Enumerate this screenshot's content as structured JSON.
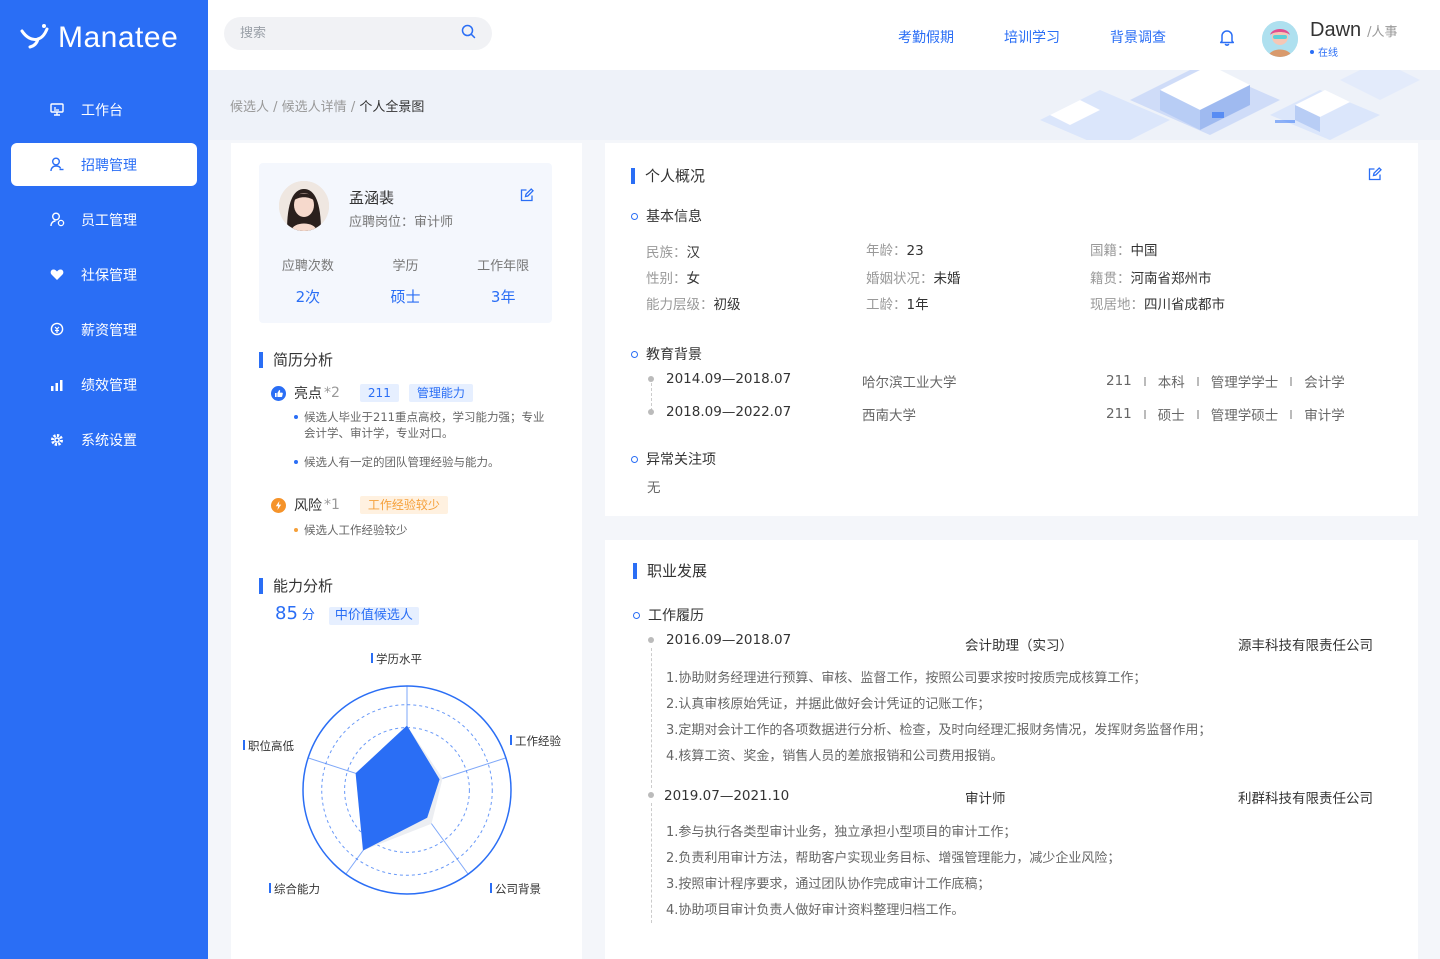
{
  "brand": {
    "name": "Manatee"
  },
  "sidebar": {
    "items": [
      {
        "label": "工作台",
        "icon": "monitor-icon",
        "active": false
      },
      {
        "label": "招聘管理",
        "icon": "user-icon",
        "active": true
      },
      {
        "label": "员工管理",
        "icon": "user-gear-icon",
        "active": false
      },
      {
        "label": "社保管理",
        "icon": "shield-heart-icon",
        "active": false
      },
      {
        "label": "薪资管理",
        "icon": "money-icon",
        "active": false
      },
      {
        "label": "绩效管理",
        "icon": "bar-chart-icon",
        "active": false
      },
      {
        "label": "系统设置",
        "icon": "gear-icon",
        "active": false
      }
    ]
  },
  "header": {
    "search_placeholder": "搜索",
    "links": [
      "考勤假期",
      "培训学习",
      "背景调查"
    ],
    "user": {
      "name": "Dawn",
      "role": "/人事",
      "status": "在线"
    }
  },
  "breadcrumb": {
    "items": [
      "候选人",
      "候选人详情"
    ],
    "current": "个人全景图"
  },
  "profile": {
    "name": "孟涵裴",
    "position_label": "应聘岗位：",
    "position": "审计师",
    "stats": [
      {
        "label": "应聘次数",
        "value": "2次"
      },
      {
        "label": "学历",
        "value": "硕士"
      },
      {
        "label": "工作年限",
        "value": "3年"
      }
    ]
  },
  "resume_analysis": {
    "title": "简历分析",
    "highlight": {
      "label": "亮点",
      "count": "*2",
      "tags": [
        "211",
        "管理能力"
      ],
      "bullets": [
        "候选人毕业于211重点高校，学习能力强；专业",
        "会计学、审计学，专业对口。",
        "候选人有一定的团队管理经验与能力。"
      ]
    },
    "risk": {
      "label": "风险",
      "count": "*1",
      "tags": [
        "工作经验较少"
      ],
      "bullets": [
        "候选人工作经验较少"
      ]
    }
  },
  "ability": {
    "title": "能力分析",
    "score": "85",
    "score_unit": "分",
    "tag": "中价值候选人",
    "axes": [
      "学历水平",
      "工作经验",
      "公司背景",
      "综合能力",
      "职位高低"
    ],
    "values": [
      0.62,
      0.33,
      0.33,
      0.72,
      0.52
    ],
    "benchmark": [
      0.62,
      0.36,
      0.4,
      0.72,
      0.52
    ],
    "colors": {
      "fill": "#2a6ef5",
      "ring": "#2a6ef5"
    }
  },
  "overview": {
    "title": "个人概况",
    "basic_title": "基本信息",
    "basic": [
      {
        "k": "民族：",
        "v": "汉"
      },
      {
        "k": "年龄：",
        "v": "23"
      },
      {
        "k": "国籍：",
        "v": "中国"
      },
      {
        "k": "性别：",
        "v": "女"
      },
      {
        "k": "婚姻状况：",
        "v": "未婚"
      },
      {
        "k": "籍贯：",
        "v": "河南省郑州市"
      },
      {
        "k": "能力层级：",
        "v": "初级"
      },
      {
        "k": "工龄：",
        "v": "1年"
      },
      {
        "k": "现居地：",
        "v": "四川省成都市"
      }
    ],
    "edu_title": "教育背景",
    "education": [
      {
        "period": "2014.09—2018.07",
        "school": "哈尔滨工业大学",
        "tags": [
          "211",
          "本科",
          "管理学学士",
          "会计学"
        ]
      },
      {
        "period": "2018.09—2022.07",
        "school": "西南大学",
        "tags": [
          "211",
          "硕士",
          "管理学硕士",
          "审计学"
        ]
      }
    ],
    "abnormal_title": "异常关注项",
    "abnormal": "无"
  },
  "career": {
    "title": "职业发展",
    "history_title": "工作履历",
    "jobs": [
      {
        "period": "2016.09—2018.07",
        "role": "会计助理（实习）",
        "company": "源丰科技有限责任公司",
        "duties": [
          "1.协助财务经理进行预算、审核、监督工作，按照公司要求按时按质完成核算工作；",
          "2.认真审核原始凭证，并据此做好会计凭证的记账工作；",
          "3.定期对会计工作的各项数据进行分析、检查，及时向经理汇报财务情况，发挥财务监督作用；",
          "4.核算工资、奖金，销售人员的差旅报销和公司费用报销。"
        ]
      },
      {
        "period": "2019.07—2021.10",
        "role": "审计师",
        "company": "利群科技有限责任公司",
        "duties": [
          "1.参与执行各类型审计业务，独立承担小型项目的审计工作；",
          "2.负责利用审计方法，帮助客户实现业务目标、增强管理能力，减少企业风险；",
          "3.按照审计程序要求，通过团队协作完成审计工作底稿；",
          "4.协助项目审计负责人做好审计资料整理归档工作。"
        ]
      }
    ]
  }
}
